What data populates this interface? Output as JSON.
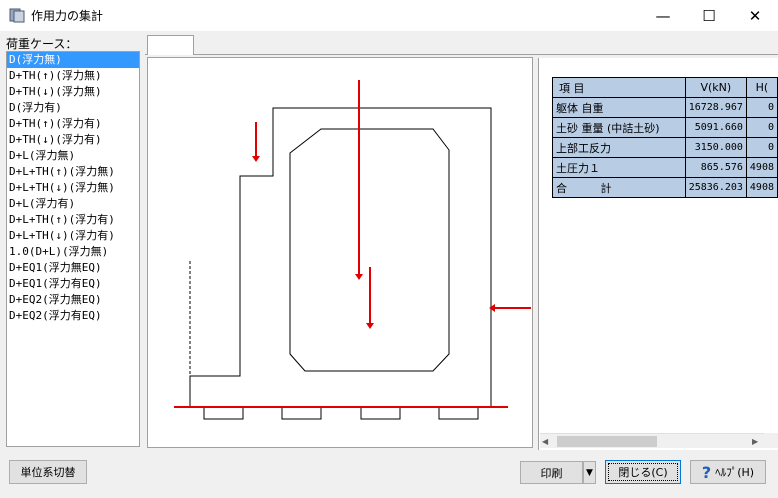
{
  "window": {
    "title": "作用力の集計",
    "icon": "app-window-icon",
    "minimize_glyph": "—",
    "maximize_glyph": "☐",
    "close_glyph": "✕"
  },
  "load_cases": {
    "label": "荷重ケース：",
    "selected_index": 0,
    "items": [
      "D(浮力無)",
      "D+TH(↑)(浮力無)",
      "D+TH(↓)(浮力無)",
      "D(浮力有)",
      "D+TH(↑)(浮力有)",
      "D+TH(↓)(浮力有)",
      "D+L(浮力無)",
      "D+L+TH(↑)(浮力無)",
      "D+L+TH(↓)(浮力無)",
      "D+L(浮力有)",
      "D+L+TH(↑)(浮力有)",
      "D+L+TH(↓)(浮力有)",
      "1.0(D+L)(浮力無)",
      "D+EQ1(浮力無EQ)",
      "D+EQ1(浮力有EQ)",
      "D+EQ2(浮力無EQ)",
      "D+EQ2(浮力有EQ)"
    ]
  },
  "force_table": {
    "headers": [
      "項 目",
      "V(kN)",
      "H("
    ],
    "rows": [
      [
        "躯体 自重",
        "16728.967",
        "0"
      ],
      [
        "土砂 重量 (中詰土砂)",
        "5091.660",
        "0"
      ],
      [
        "上部工反力",
        "3150.000",
        "0"
      ],
      [
        "土圧力１",
        "865.576",
        "4908"
      ],
      [
        "合 計",
        "25836.203",
        "4908"
      ]
    ]
  },
  "colors": {
    "selection": "#3399ff",
    "table_cell": "#b8cce4",
    "force_arrow": "#e00000",
    "structure_line": "#000000"
  },
  "buttons": {
    "units": "単位系切替",
    "print": "印刷",
    "print_dropdown": "▼",
    "close": "閉じる(C)",
    "help_icon": "?",
    "help": "ﾍﾙﾌﾟ(H)"
  },
  "scrollbar": {
    "left_glyph": "◀",
    "right_glyph": "▶"
  }
}
